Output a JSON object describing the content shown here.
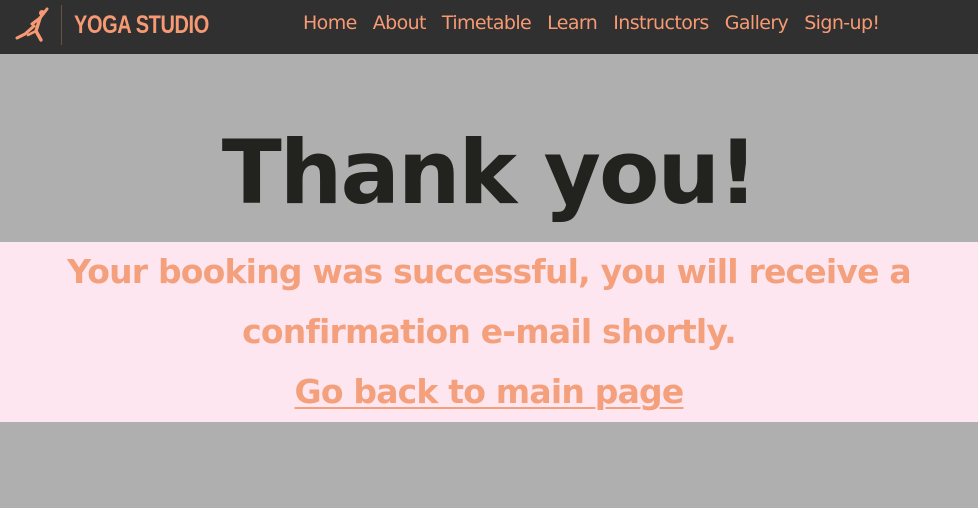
{
  "brand": {
    "logo_icon": "yoga-pose-icon",
    "name": "YOGA STUDIO",
    "accent_color": "#f79a74"
  },
  "nav": {
    "items": [
      {
        "label": "Home"
      },
      {
        "label": "About"
      },
      {
        "label": "Timetable"
      },
      {
        "label": "Learn"
      },
      {
        "label": "Instructors"
      },
      {
        "label": "Gallery"
      },
      {
        "label": "Sign-up!"
      }
    ]
  },
  "hero": {
    "title": "Thank you!"
  },
  "message": {
    "line1": "Your booking was successful, you will receive a",
    "line2": "confirmation e-mail shortly.",
    "back_link": "Go back to main page"
  }
}
